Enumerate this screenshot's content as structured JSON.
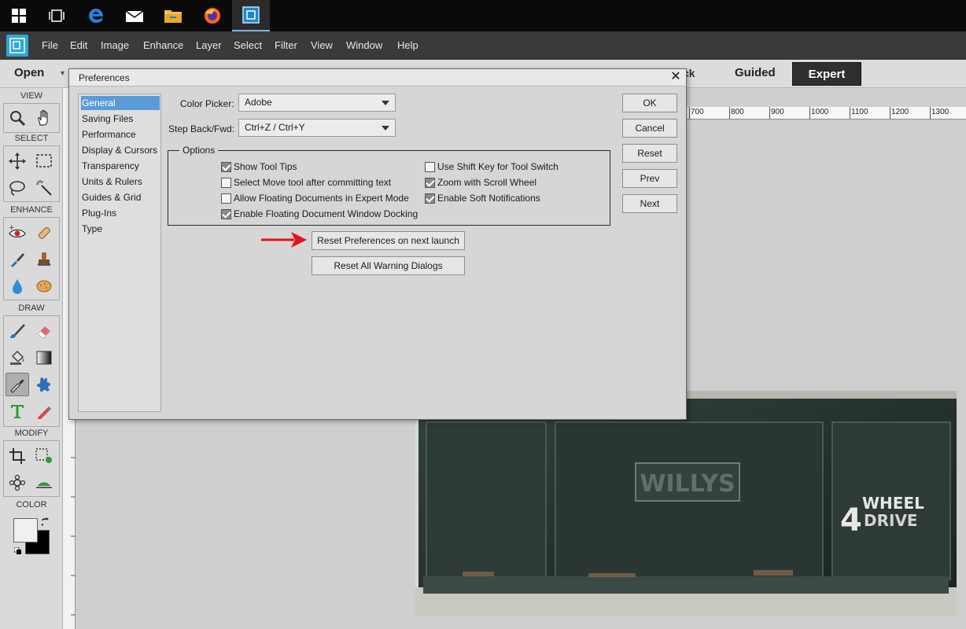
{
  "taskbar": {
    "icons": [
      {
        "name": "windows-start-icon"
      },
      {
        "name": "task-view-icon"
      },
      {
        "name": "edge-browser-icon"
      },
      {
        "name": "mail-icon"
      },
      {
        "name": "file-explorer-icon"
      },
      {
        "name": "firefox-icon"
      },
      {
        "name": "photoshop-elements-icon"
      }
    ]
  },
  "menubar": {
    "items": [
      "File",
      "Edit",
      "Image",
      "Enhance",
      "Layer",
      "Select",
      "Filter",
      "View",
      "Window",
      "Help"
    ]
  },
  "modebar": {
    "open_label": "Open",
    "quick_label": "ck",
    "guided_label": "Guided",
    "expert_label": "Expert"
  },
  "toolbox": {
    "sections": {
      "view": "VIEW",
      "select": "SELECT",
      "enhance": "ENHANCE",
      "draw": "DRAW",
      "modify": "MODIFY",
      "color": "COLOR"
    }
  },
  "ruler": {
    "labels": [
      "700",
      "800",
      "900",
      "1000",
      "1100",
      "1200",
      "1300"
    ]
  },
  "photo": {
    "text": "WILLYS",
    "side_text_number": "4",
    "side_text_1": "WHEEL",
    "side_text_2": "DRIVE"
  },
  "dialog": {
    "title": "Preferences",
    "categories": [
      "General",
      "Saving Files",
      "Performance",
      "Display & Cursors",
      "Transparency",
      "Units & Rulers",
      "Guides & Grid",
      "Plug-Ins",
      "Type"
    ],
    "selected_category": "General",
    "color_picker_label": "Color Picker:",
    "color_picker_value": "Adobe",
    "step_back_label": "Step Back/Fwd:",
    "step_back_value": "Ctrl+Z / Ctrl+Y",
    "options_legend": "Options",
    "options": {
      "show_tool_tips": {
        "label": "Show Tool Tips",
        "checked": true
      },
      "select_move_tool": {
        "label": "Select Move tool after committing text",
        "checked": false
      },
      "allow_floating": {
        "label": "Allow Floating Documents in Expert Mode",
        "checked": false
      },
      "enable_floating_docking": {
        "label": "Enable Floating Document Window Docking",
        "checked": true
      },
      "use_shift_key": {
        "label": "Use Shift Key for Tool Switch",
        "checked": false
      },
      "zoom_scroll_wheel": {
        "label": "Zoom with Scroll Wheel",
        "checked": true
      },
      "enable_soft_notifications": {
        "label": "Enable Soft Notifications",
        "checked": true
      }
    },
    "reset_prefs_label": "Reset Preferences on next launch",
    "reset_warnings_label": "Reset All Warning Dialogs",
    "ok_label": "OK",
    "cancel_label": "Cancel",
    "reset_label": "Reset",
    "prev_label": "Prev",
    "next_label": "Next",
    "close_label": "✕"
  },
  "colors": {
    "accent_selected": "#5b9bd8",
    "arrow_red": "#e0141b",
    "expert_bg": "#2f2f2f"
  }
}
